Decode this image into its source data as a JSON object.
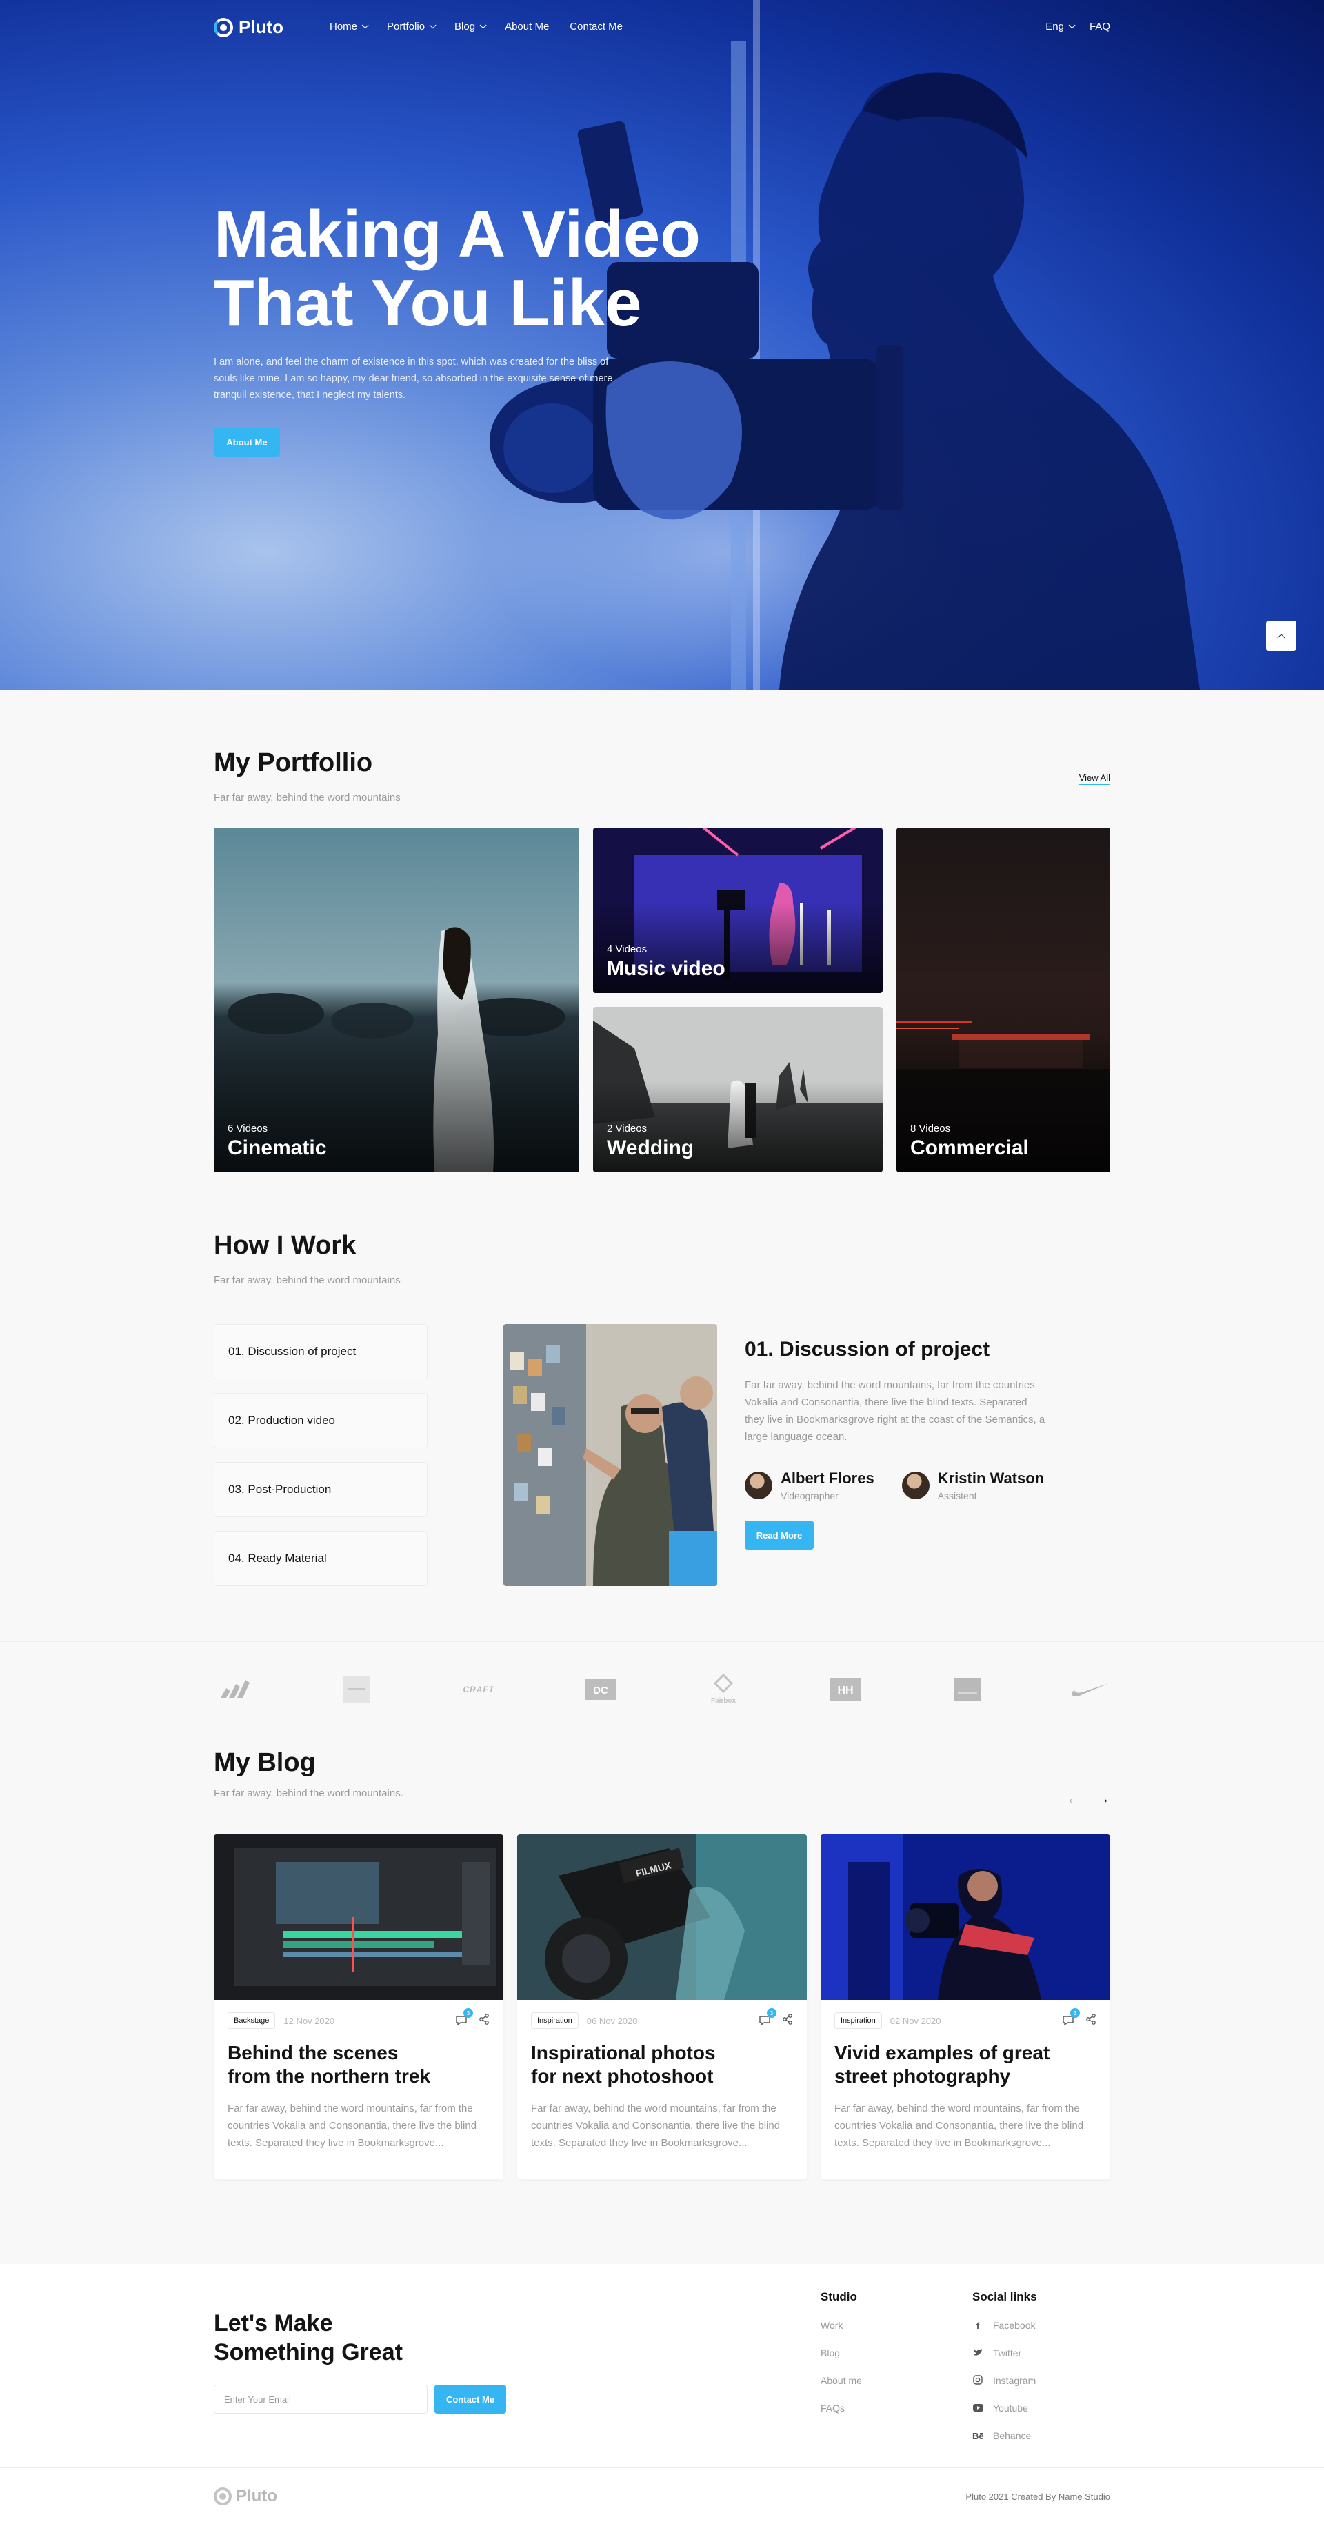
{
  "nav": {
    "logo": "Pluto",
    "items": [
      {
        "label": "Home",
        "dropdown": true
      },
      {
        "label": "Portfolio",
        "dropdown": true
      },
      {
        "label": "Blog",
        "dropdown": true
      },
      {
        "label": "About Me",
        "dropdown": false
      },
      {
        "label": "Contact Me",
        "dropdown": false
      }
    ],
    "language": "Eng",
    "faq": "FAQ"
  },
  "hero": {
    "title_line1": "Making A Video",
    "title_line2": "That You Like",
    "text": "I am alone, and feel the charm of existence in this spot, which was created for the bliss of souls like mine. I am so happy, my dear friend, so absorbed in the exquisite sense of mere tranquil existence, that I neglect my talents.",
    "button": "About Me"
  },
  "portfolio": {
    "title": "My Portfollio",
    "subtitle": "Far far away, behind the word mountains",
    "view_all": "View All",
    "cards": [
      {
        "count": "6 Videos",
        "name": "Cinematic"
      },
      {
        "count": "4 Videos",
        "name": "Music video"
      },
      {
        "count": "2 Videos",
        "name": "Wedding"
      },
      {
        "count": "8 Videos",
        "name": "Commercial"
      }
    ]
  },
  "how": {
    "title": "How I Work",
    "subtitle": "Far far away, behind the word mountains",
    "steps": [
      "01. Discussion of project",
      "02. Production video",
      "03. Post-Production",
      "04. Ready Material"
    ],
    "detail_title": "01. Discussion of project",
    "detail_text": "Far far away, behind the word mountains, far from the countries Vokalia and Consonantia, there live the blind texts. Separated they live in Bookmarksgrove right at the coast of the Semantics, a large language ocean.",
    "people": [
      {
        "name": "Albert Flores",
        "role": "Videographer"
      },
      {
        "name": "Kristin Watson",
        "role": "Assistent"
      }
    ],
    "button": "Read More"
  },
  "brands": [
    "adidas",
    "",
    "CRAFT",
    "DC",
    "Fairbox",
    "HH",
    "",
    "nike"
  ],
  "blog": {
    "title": "My Blog",
    "subtitle": "Far far away, behind the word mountains.",
    "posts": [
      {
        "tag": "Backstage",
        "date": "12 Nov 2020",
        "comments": "3",
        "title_line1": "Behind the scenes",
        "title_line2": "from the northern trek",
        "excerpt": "Far far away, behind the word mountains, far from the countries Vokalia and Consonantia, there live the blind texts. Separated they live in Bookmarksgrove..."
      },
      {
        "tag": "Inspiration",
        "date": "06 Nov 2020",
        "comments": "3",
        "title_line1": "Inspirational photos",
        "title_line2": "for next photoshoot",
        "excerpt": "Far far away, behind the word mountains, far from the countries Vokalia and Consonantia, there live the blind texts. Separated they live in Bookmarksgrove..."
      },
      {
        "tag": "Inspiration",
        "date": "02 Nov 2020",
        "comments": "3",
        "title_line1": "Vivid examples of great",
        "title_line2": "street photography",
        "excerpt": "Far far away, behind the word mountains, far from the countries Vokalia and Consonantia, there live the blind texts. Separated they live in Bookmarksgrove..."
      }
    ]
  },
  "footer": {
    "title_line1": "Let's Make",
    "title_line2": "Something Great",
    "email_placeholder": "Enter Your Email",
    "contact_button": "Contact Me",
    "studio_title": "Studio",
    "studio_links": [
      "Work",
      "Blog",
      "About me",
      "FAQs"
    ],
    "social_title": "Social links",
    "social_links": [
      {
        "icon": "facebook-icon",
        "label": "Facebook"
      },
      {
        "icon": "twitter-icon",
        "label": "Twitter"
      },
      {
        "icon": "instagram-icon",
        "label": "Instagram"
      },
      {
        "icon": "youtube-icon",
        "label": "Youtube"
      },
      {
        "icon": "behance-icon",
        "label": "Behance"
      }
    ],
    "logo": "Pluto",
    "copyright": "Pluto 2021 Created By Name Studio"
  },
  "colors": {
    "accent": "#35b6f2",
    "hero_blue": "#2a57c9",
    "text_dark": "#141414",
    "text_muted": "#9a9a9a"
  }
}
